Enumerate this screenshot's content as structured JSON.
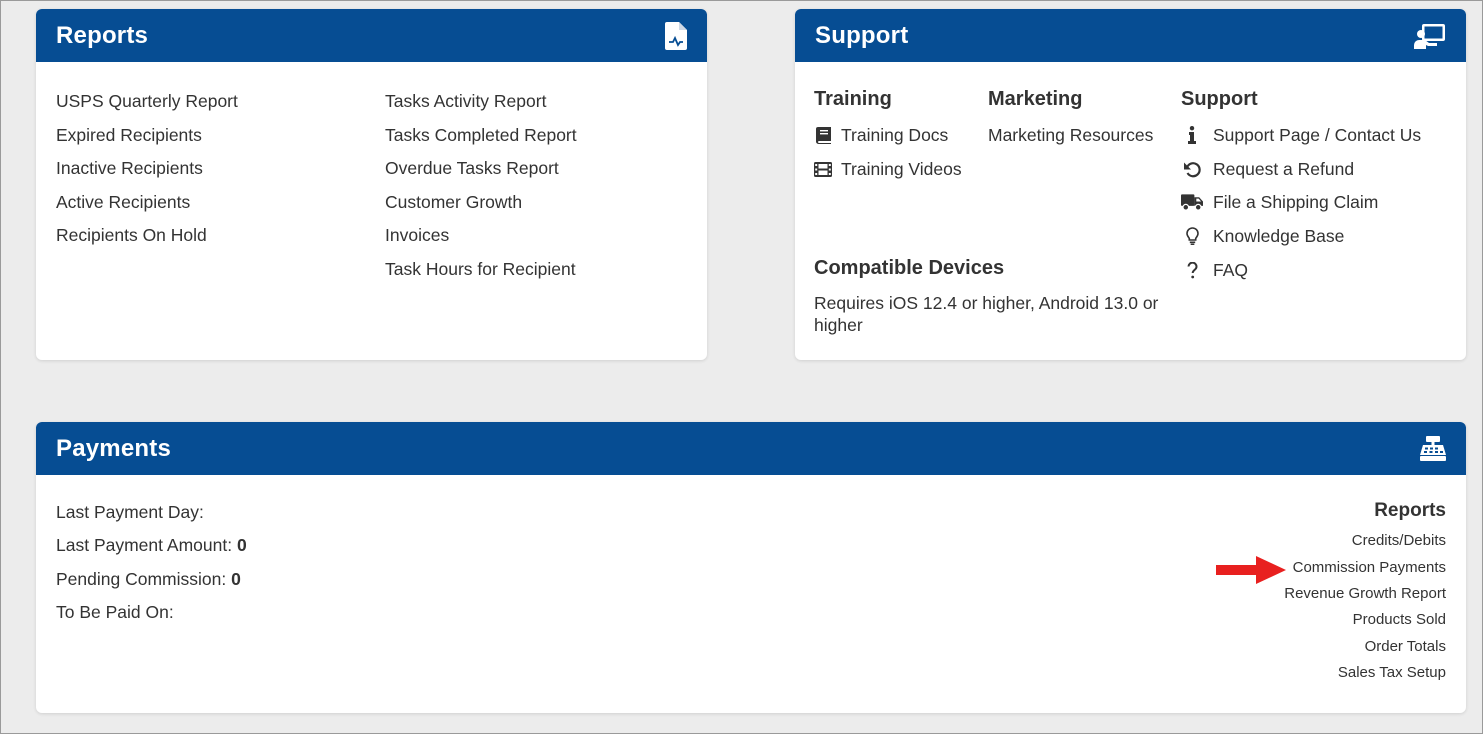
{
  "reports": {
    "title": "Reports",
    "icon": "file-report-icon",
    "left_links": [
      "USPS Quarterly Report",
      "Expired Recipients",
      "Inactive Recipients",
      "Active Recipients",
      "Recipients On Hold"
    ],
    "right_links": [
      "Tasks Activity Report",
      "Tasks Completed Report",
      "Overdue Tasks Report",
      "Customer Growth",
      "Invoices",
      "Task Hours for Recipient"
    ]
  },
  "support": {
    "title": "Support",
    "icon": "support-desk-icon",
    "training": {
      "heading": "Training",
      "links": [
        {
          "label": "Training Docs",
          "icon": "book-icon"
        },
        {
          "label": "Training Videos",
          "icon": "film-icon"
        }
      ]
    },
    "marketing": {
      "heading": "Marketing",
      "links": [
        {
          "label": "Marketing Resources"
        }
      ]
    },
    "support_section": {
      "heading": "Support",
      "links": [
        {
          "label": "Support Page / Contact Us",
          "icon": "info-icon"
        },
        {
          "label": "Request a Refund",
          "icon": "undo-icon"
        },
        {
          "label": "File a Shipping Claim",
          "icon": "truck-icon"
        },
        {
          "label": "Knowledge Base",
          "icon": "lightbulb-icon"
        },
        {
          "label": "FAQ",
          "icon": "question-icon"
        }
      ]
    },
    "devices": {
      "heading": "Compatible Devices",
      "text": "Requires iOS 12.4 or higher, Android 13.0 or higher"
    }
  },
  "payments": {
    "title": "Payments",
    "icon": "cash-register-icon",
    "fields": [
      {
        "label": "Last Payment Day:",
        "value": ""
      },
      {
        "label": "Last Payment Amount:",
        "value": "0"
      },
      {
        "label": "Pending Commission:",
        "value": "0"
      },
      {
        "label": "To Be Paid On:",
        "value": ""
      }
    ],
    "reports_heading": "Reports",
    "report_links": [
      "Credits/Debits",
      "Commission Payments",
      "Revenue Growth Report",
      "Products Sold",
      "Order Totals",
      "Sales Tax Setup"
    ]
  },
  "annotation": {
    "icon": "red-arrow-icon",
    "color": "#e8201f",
    "points_to": "Commission Payments"
  },
  "colors": {
    "header": "#064d93",
    "background": "#ececec",
    "text": "#333333"
  }
}
